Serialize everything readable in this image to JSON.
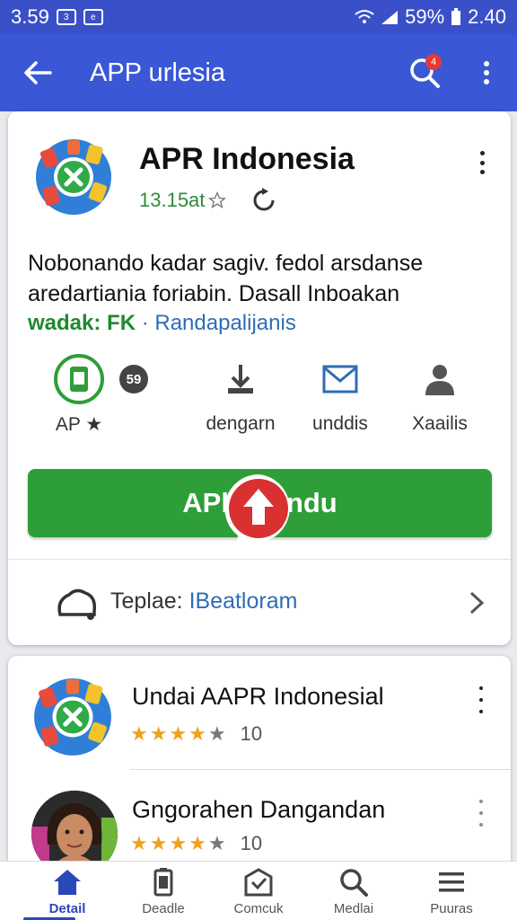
{
  "status_bar": {
    "time": "3.59",
    "battery": "59%",
    "clock": "2.40",
    "icons": [
      "sim-3-icon",
      "browser-icon",
      "wifi-icon",
      "signal-icon",
      "battery-icon"
    ]
  },
  "app_bar": {
    "title": "APP urlesia",
    "notification_count": "4",
    "icons": [
      "back-arrow-icon",
      "search-icon",
      "overflow-menu-icon"
    ]
  },
  "app": {
    "name": "APR Indonesia",
    "rating_text": "13.15at",
    "description_line1": "Nobonando kadar sagiv. fedol arsdanse",
    "description_line2": "aredartiania foriabin. Dasall Inboakan",
    "meta_green": "wadak: FK",
    "meta_separator": "·",
    "meta_blue": "Randapalijanis",
    "actions": [
      {
        "label": "AP ★",
        "badge": "59",
        "icon": "app-info-icon"
      },
      {
        "label": "dengarn",
        "icon": "download-icon"
      },
      {
        "label": "unddis",
        "icon": "mail-icon"
      },
      {
        "label": "Xaailis",
        "icon": "person-icon"
      }
    ],
    "install_left": "APl",
    "install_right": "ndu",
    "template_prefix": "Teplae: ",
    "template_link": "IBeatloram"
  },
  "list": [
    {
      "title": "Undai AAPR Indonesial",
      "stars": 4,
      "count": "10",
      "icon": "app-logo-icon"
    },
    {
      "title": "Gngorahen Dangandan",
      "stars": 4,
      "count": "10",
      "icon": "avatar-photo"
    }
  ],
  "bottom_nav": [
    {
      "label": "Detail",
      "icon": "home-icon",
      "active": true
    },
    {
      "label": "Deadle",
      "icon": "phone-icon",
      "active": false
    },
    {
      "label": "Comcuk",
      "icon": "mail-check-icon",
      "active": false
    },
    {
      "label": "Medlai",
      "icon": "search-icon",
      "active": false
    },
    {
      "label": "Puuras",
      "icon": "menu-icon",
      "active": false
    }
  ],
  "colors": {
    "status_bar": "#3a50c8",
    "app_bar": "#3a58d6",
    "install": "#2e9e38",
    "accent_blue": "#2949b8",
    "star": "#f0a21d"
  }
}
